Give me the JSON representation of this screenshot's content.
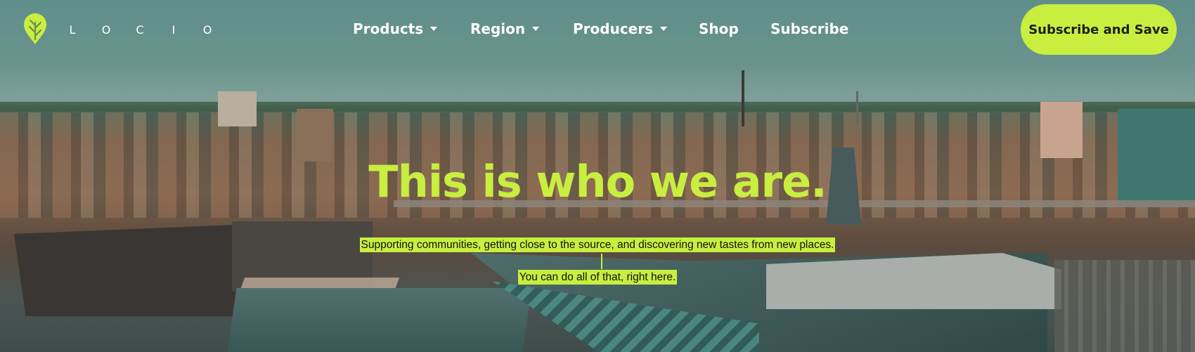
{
  "brand": {
    "logo_icon": "leaf-pin-icon",
    "wordmark_letters": [
      "L",
      "O",
      "C",
      "I",
      "O"
    ]
  },
  "nav": {
    "items": [
      {
        "label": "Products",
        "has_dropdown": true
      },
      {
        "label": "Region",
        "has_dropdown": true
      },
      {
        "label": "Producers",
        "has_dropdown": true
      },
      {
        "label": "Shop",
        "has_dropdown": false
      },
      {
        "label": "Subscribe",
        "has_dropdown": false
      }
    ],
    "cta_label": "Subscribe and Save"
  },
  "hero": {
    "headline": "This is who we are.",
    "subtext_1": "Supporting communities, getting close to the source, and discovering new tastes from new places.",
    "subtext_2": "You can do all of that, right here."
  },
  "colors": {
    "accent": "#c8ee3f",
    "nav_text": "#ffffff",
    "cta_text": "#1b1f18"
  }
}
